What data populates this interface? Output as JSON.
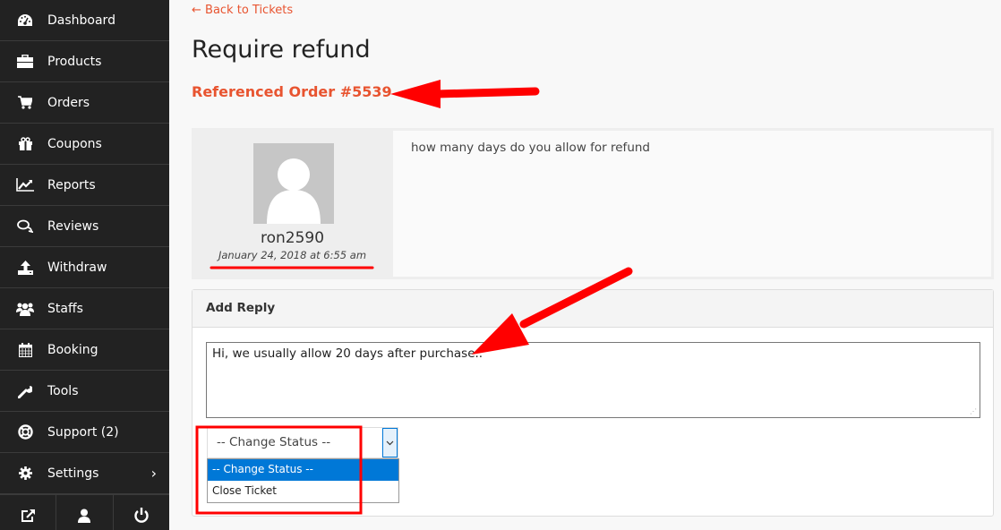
{
  "sidebar": {
    "items": [
      {
        "label": "Dashboard",
        "icon": "dashboard-icon"
      },
      {
        "label": "Products",
        "icon": "briefcase-icon"
      },
      {
        "label": "Orders",
        "icon": "cart-icon"
      },
      {
        "label": "Coupons",
        "icon": "gift-icon"
      },
      {
        "label": "Reports",
        "icon": "line-chart-icon"
      },
      {
        "label": "Reviews",
        "icon": "comments-icon"
      },
      {
        "label": "Withdraw",
        "icon": "upload-icon"
      },
      {
        "label": "Staffs",
        "icon": "users-icon"
      },
      {
        "label": "Booking",
        "icon": "calendar-icon"
      },
      {
        "label": "Tools",
        "icon": "wrench-icon"
      },
      {
        "label": "Support (2)",
        "icon": "life-ring-icon"
      },
      {
        "label": "Settings",
        "icon": "gear-icon",
        "chevron": "›"
      }
    ],
    "bottom": [
      "external-link-icon",
      "user-icon",
      "power-icon"
    ]
  },
  "main": {
    "back_link": "← Back to Tickets",
    "title": "Require refund",
    "order_ref": "Referenced Order #5539",
    "ticket": {
      "author": "ron2590",
      "date": "January 24, 2018 at 6:55 am",
      "message": "how many days do you allow for refund"
    },
    "reply": {
      "heading": "Add Reply",
      "text": "Hi, we usually allow 20 days after purchase..",
      "status_select": {
        "value": "-- Change Status --",
        "options": [
          "-- Change Status --",
          "Close Ticket"
        ],
        "highlighted": "-- Change Status --"
      }
    }
  },
  "colors": {
    "accent": "#e85430",
    "sidebar_bg": "#222222",
    "annotation": "#ff0000",
    "select_highlight": "#0078d7"
  }
}
